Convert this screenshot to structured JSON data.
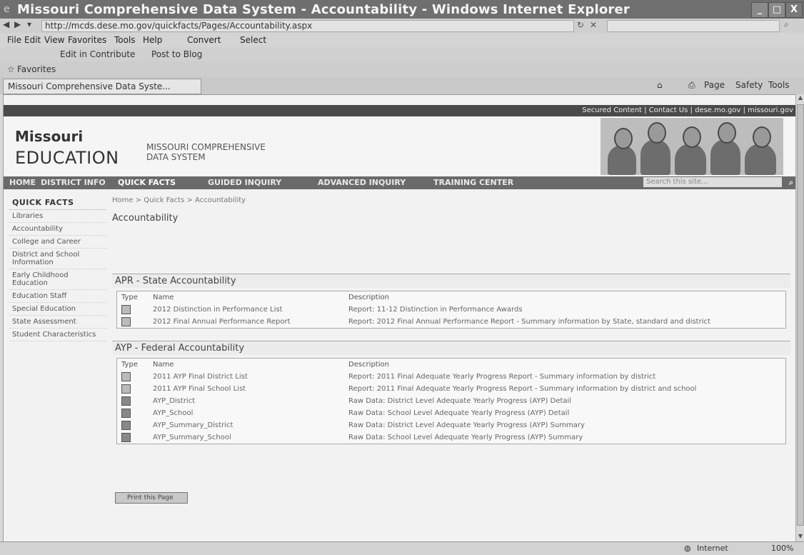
{
  "window": {
    "title": "Missouri Comprehensive Data System - Accountability - Windows Internet Explorer",
    "buttons": {
      "minimize": "_",
      "maximize": "□",
      "close": "X"
    }
  },
  "address_bar": {
    "url": "http://mcds.dese.mo.gov/quickfacts/Pages/Accountability.aspx"
  },
  "menu": [
    "File",
    "Edit",
    "View",
    "Favorites",
    "Tools",
    "Help"
  ],
  "menu_extras": {
    "convert": "Convert",
    "select": "Select"
  },
  "contribute_bar": {
    "edit": "Edit in Contribute",
    "post": "Post to Blog"
  },
  "favorites_bar": {
    "label": "Favorites"
  },
  "tab": {
    "title": "Missouri Comprehensive Data Syste..."
  },
  "command_bar": {
    "page": "Page",
    "safety": "Safety",
    "tools": "Tools"
  },
  "site": {
    "top_links": [
      "Secured Content",
      "Contact Us",
      "dese.mo.gov",
      "missouri.gov"
    ],
    "logo_top": "Missouri",
    "logo_bottom": "EDUCATION",
    "site_name_line1": "MISSOURI COMPREHENSIVE",
    "site_name_line2": "DATA SYSTEM",
    "nav": [
      "HOME",
      "DISTRICT INFO",
      "QUICK FACTS",
      "GUIDED INQUIRY",
      "ADVANCED INQUIRY",
      "TRAINING CENTER"
    ],
    "search_placeholder": "Search this site..."
  },
  "sidebar": {
    "heading": "QUICK FACTS",
    "items": [
      "Libraries",
      "Accountability",
      "College and Career",
      "District and School Information",
      "Early Childhood Education",
      "Education Staff",
      "Special Education",
      "State Assessment",
      "Student Characteristics"
    ]
  },
  "breadcrumb": "Home > Quick Facts > Accountability",
  "page_title": "Accountability",
  "columns": {
    "type": "Type",
    "name": "Name",
    "description": "Description"
  },
  "apr": {
    "title": "APR - State Accountability",
    "rows": [
      {
        "name": "2012 Distinction in Performance List",
        "desc": "Report: 11-12 Distinction in Performance Awards"
      },
      {
        "name": "2012 Final Annual Performance Report",
        "desc": "Report: 2012 Final Annual Performance Report - Summary information by State, standard and district"
      }
    ]
  },
  "ayp": {
    "title": "AYP - Federal Accountability",
    "rows": [
      {
        "name": "2011 AYP Final District List",
        "desc": "Report: 2011 Final Adequate Yearly Progress Report - Summary information by district"
      },
      {
        "name": "2011 AYP Final School List",
        "desc": "Report: 2011 Final Adequate Yearly Progress Report - Summary information by district and school"
      },
      {
        "name": "AYP_District",
        "desc": "Raw Data: District Level Adequate Yearly Progress (AYP) Detail"
      },
      {
        "name": "AYP_School",
        "desc": "Raw Data: School Level Adequate Yearly Progress (AYP) Detail"
      },
      {
        "name": "AYP_Summary_District",
        "desc": "Raw Data: District Level Adequate Yearly Progress (AYP) Summary"
      },
      {
        "name": "AYP_Summary_School",
        "desc": "Raw Data: School Level Adequate Yearly Progress (AYP) Summary"
      }
    ]
  },
  "print_label": "Print this Page",
  "status": {
    "zone": "Internet",
    "zoom": "100%"
  },
  "icons": [
    "ie-icon",
    "back-icon",
    "forward-icon",
    "refresh-icon",
    "stop-icon",
    "search-icon",
    "home-icon",
    "print-icon",
    "document-icon",
    "report-icon"
  ]
}
